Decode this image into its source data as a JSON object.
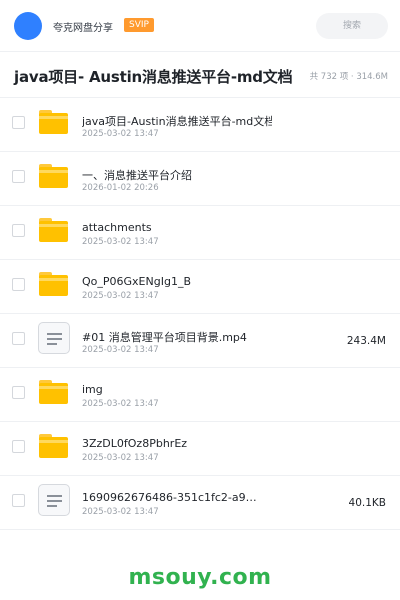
{
  "header": {
    "share_name": "夸克网盘分享",
    "badge": "SVIP",
    "search_placeholder": "搜索"
  },
  "title_bar": {
    "title": "java项目- Austin消息推送平台-md文档",
    "stats": "共 732 项 · 314.6M"
  },
  "files": [
    {
      "type": "folder",
      "name": "java项目-Austin消息推送平台-md文档",
      "date": "2025-03-02 13:47",
      "size": ""
    },
    {
      "type": "folder",
      "name": "一、消息推送平台介绍",
      "date": "2026-01-02 20:26",
      "size": ""
    },
    {
      "type": "folder",
      "name": "attachments",
      "date": "2025-03-02 13:47",
      "size": ""
    },
    {
      "type": "folder",
      "name": "Qo_P06GxENgIg1_B",
      "date": "2025-03-02 13:47",
      "size": ""
    },
    {
      "type": "file",
      "name": "#01 消息管理平台项目背景.mp4",
      "date": "2025-03-02 13:47",
      "size": "243.4M"
    },
    {
      "type": "folder",
      "name": "img",
      "date": "2025-03-02 13:47",
      "size": ""
    },
    {
      "type": "folder",
      "name": "3ZzDL0fOz8PbhrEz",
      "date": "2025-03-02 13:47",
      "size": ""
    },
    {
      "type": "file",
      "name": "1690962676486-351c1fc2-a9…",
      "date": "2025-03-02 13:47",
      "size": "40.1KB"
    }
  ],
  "footer": {
    "watermark": "msouy.com"
  },
  "colors": {
    "avatar": "#2f80ff",
    "badge": "#ff9a2e",
    "folder": "#ffc100",
    "watermark": "#31b24f"
  },
  "icons": {
    "folder": "folder-icon",
    "file": "document-icon"
  }
}
